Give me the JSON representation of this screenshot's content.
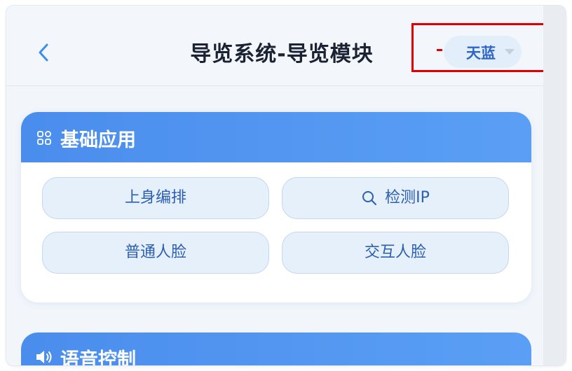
{
  "header": {
    "title": "导览系统-导览模块",
    "theme_value": "天蓝"
  },
  "sections": [
    {
      "title": "基础应用",
      "icon": "grid-icon",
      "buttons": [
        {
          "label": "上身编排"
        },
        {
          "label": "检测IP",
          "icon": "search-icon"
        },
        {
          "label": "普通人脸"
        },
        {
          "label": "交互人脸"
        }
      ]
    },
    {
      "title": "语音控制",
      "icon": "speaker-icon"
    }
  ],
  "colors": {
    "accent": "#4a8ded",
    "button_text": "#2c5fb1",
    "highlight": "#e00000"
  }
}
